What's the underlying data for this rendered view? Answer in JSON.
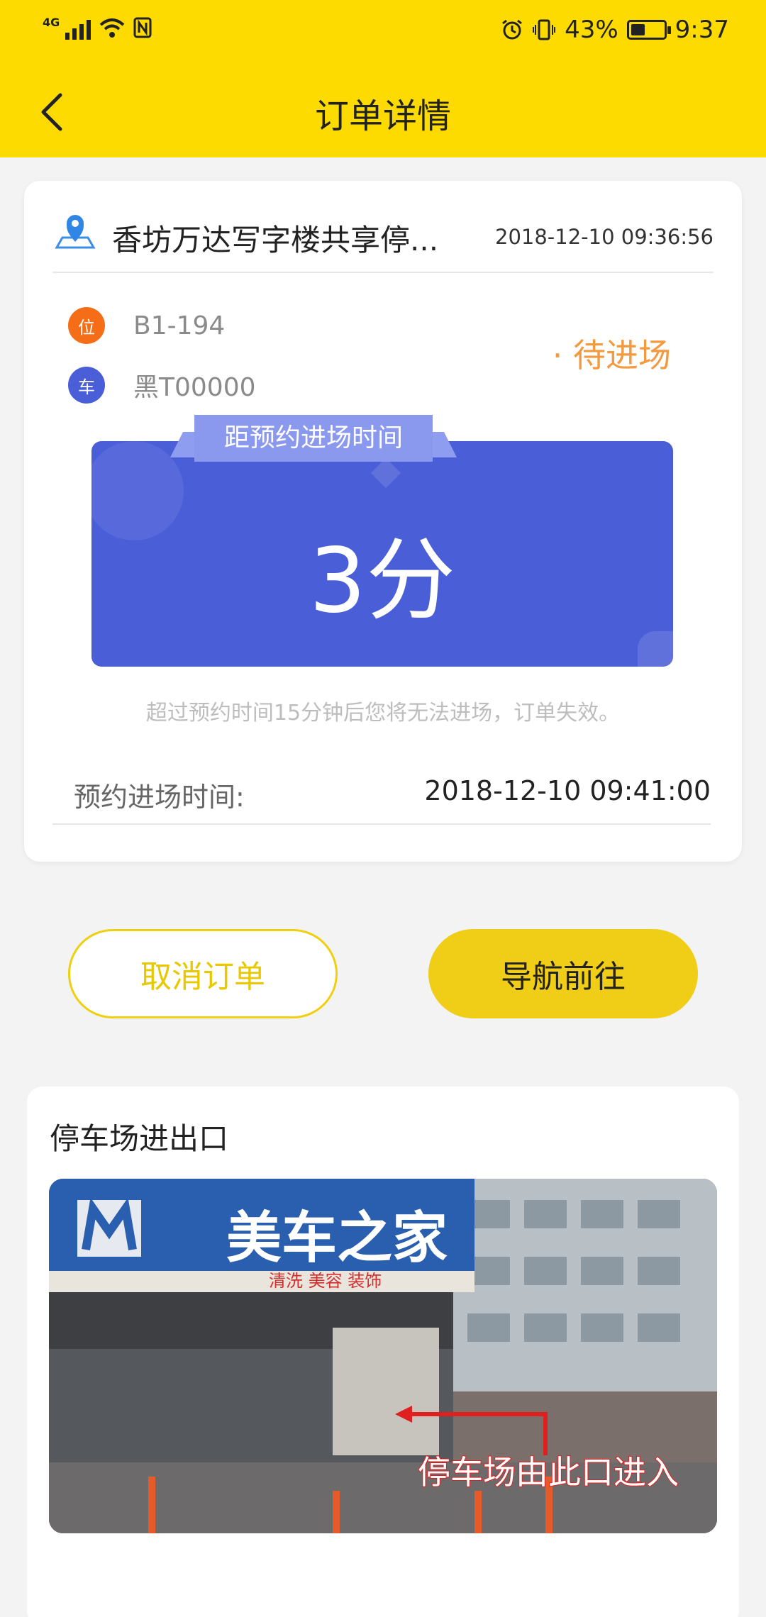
{
  "status_bar": {
    "network": "4G",
    "battery_percent": "43%",
    "battery_level": 0.43,
    "time": "9:37"
  },
  "header": {
    "title": "订单详情"
  },
  "order": {
    "lot_name": "香坊万达写字楼共享停...",
    "order_time": "2018-12-10 09:36:56",
    "space_badge": "位",
    "space": "B1-194",
    "plate_badge": "车",
    "plate": "黑T00000",
    "state": "· 待进场",
    "countdown_label": "距预约进场时间",
    "countdown_value": "3分",
    "warning": "超过预约时间15分钟后您将无法进场，订单失效。",
    "appointment_label": "预约进场时间:",
    "appointment_time": "2018-12-10 09:41:00"
  },
  "actions": {
    "cancel_label": "取消订单",
    "navigate_label": "导航前往"
  },
  "entrance": {
    "title": "停车场进出口",
    "photo_sign": "美车之家",
    "photo_sub_sign": "清洗 美容 装饰",
    "photo_caption": "停车场由此口进入"
  },
  "colors": {
    "brand_yellow": "#fedb00",
    "countdown_blue": "#4a5ed8",
    "state_orange": "#f29a3f",
    "space_badge": "#f56d16",
    "plate_badge": "#4a5ed8"
  }
}
